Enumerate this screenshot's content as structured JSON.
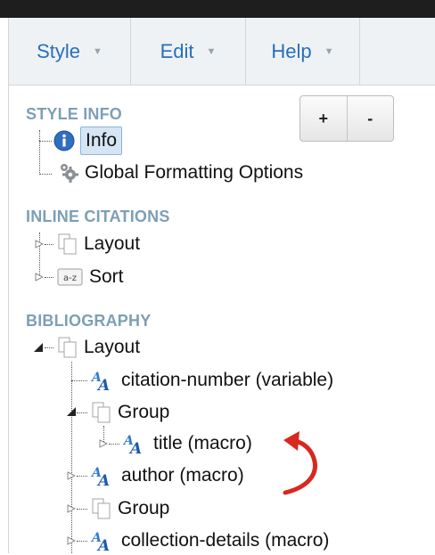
{
  "menu": {
    "style_label": "Style",
    "edit_label": "Edit",
    "help_label": "Help"
  },
  "sections": {
    "style_info": "STYLE INFO",
    "inline_citations": "INLINE CITATIONS",
    "bibliography": "BIBLIOGRAPHY"
  },
  "buttons": {
    "add_label": "+",
    "remove_label": "-"
  },
  "tree": {
    "info": "Info",
    "global_formatting": "Global Formatting Options",
    "citation_layout": "Layout",
    "citation_sort": "Sort",
    "bibliography_layout": "Layout",
    "citation_number": "citation-number (variable)",
    "group1": "Group",
    "title_macro": "title (macro)",
    "author_macro": "author (macro)",
    "group2": "Group",
    "collection_details": "collection-details (macro)"
  },
  "icons": {
    "sort_icon_text": "a-z"
  },
  "colors": {
    "accent": "#2a6fb8",
    "section_title": "#7d9fb6",
    "selected_bg": "#d5e5f4",
    "annotation_arrow": "#d8281f"
  }
}
